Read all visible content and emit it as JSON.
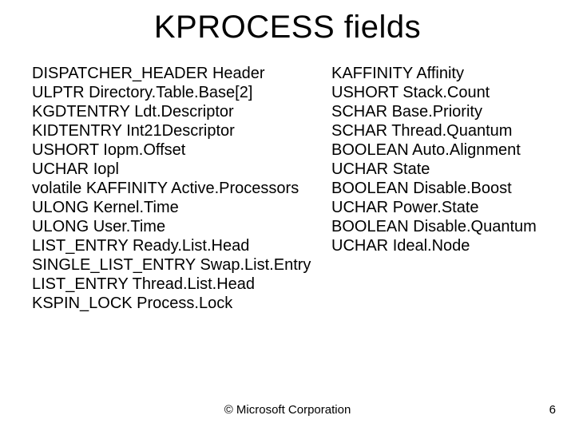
{
  "title": "KPROCESS fields",
  "left": [
    {
      "type": "DISPATCHER_HEADER",
      "name": "Header"
    },
    {
      "type": "ULPTR",
      "name": "Directory.Table.Base[2]"
    },
    {
      "type": "KGDTENTRY",
      "name": "Ldt.Descriptor"
    },
    {
      "type": "KIDTENTRY",
      "name": "Int21Descriptor"
    },
    {
      "type": "USHORT",
      "name": "Iopm.Offset"
    },
    {
      "type": "UCHAR",
      "name": "Iopl"
    },
    {
      "type": "volatile KAFFINITY",
      "name": "Active.Processors"
    },
    {
      "type": "ULONG",
      "name": "Kernel.Time"
    },
    {
      "type": "ULONG",
      "name": "User.Time"
    },
    {
      "type": "LIST_ENTRY",
      "name": "Ready.List.Head"
    },
    {
      "type": "SINGLE_LIST_ENTRY",
      "name": "Swap.List.Entry"
    },
    {
      "type": "LIST_ENTRY",
      "name": "Thread.List.Head"
    },
    {
      "type": "KSPIN_LOCK",
      "name": "Process.Lock"
    }
  ],
  "right": [
    {
      "type": "KAFFINITY",
      "name": "Affinity"
    },
    {
      "type": "USHORT",
      "name": "Stack.Count"
    },
    {
      "type": "SCHAR",
      "name": "Base.Priority"
    },
    {
      "type": "SCHAR",
      "name": "Thread.Quantum"
    },
    {
      "type": "BOOLEAN",
      "name": "Auto.Alignment"
    },
    {
      "type": "UCHAR",
      "name": "State"
    },
    {
      "type": "BOOLEAN",
      "name": "Disable.Boost"
    },
    {
      "type": "UCHAR",
      "name": "Power.State"
    },
    {
      "type": "BOOLEAN",
      "name": "Disable.Quantum"
    },
    {
      "type": "UCHAR",
      "name": "Ideal.Node"
    }
  ],
  "footer": "© Microsoft Corporation",
  "page": "6"
}
